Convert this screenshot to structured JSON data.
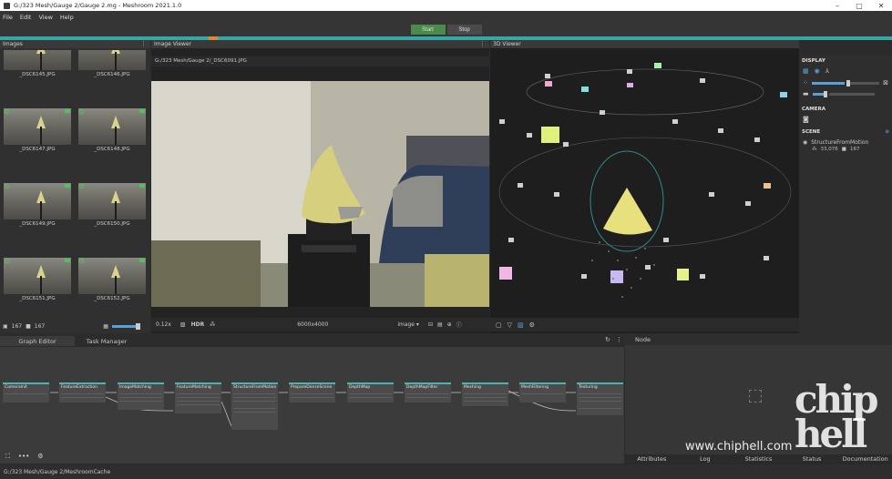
{
  "window": {
    "title": "G:/323 Mesh/Gauge 2/Gauge 2.mg - Meshroom 2021.1.0"
  },
  "menu": [
    "File",
    "Edit",
    "View",
    "Help"
  ],
  "toolbar": {
    "start_label": "Start",
    "stop_label": "Stop"
  },
  "colors": {
    "accent": "#35a7a7",
    "start": "#4a8a4a",
    "stop": "#4a4a4a",
    "progress_marker": "#e08a27",
    "camera_ok": "#4fc25b"
  },
  "images_panel": {
    "title": "Images",
    "thumbnails": [
      "_DSC6145.JPG",
      "_DSC6146.JPG",
      "_DSC6147.JPG",
      "_DSC6148.JPG",
      "_DSC6149.JPG",
      "_DSC6150.JPG",
      "_DSC6151.JPG",
      "_DSC6152.JPG"
    ],
    "image_count": "167",
    "camera_count": "167"
  },
  "image_viewer": {
    "title": "Image Viewer",
    "path": "G:/323 Mesh/Gauge 2/_DSC6091.JPG",
    "zoom": "0.12x",
    "hdr_label": "HDR",
    "resolution": "6000x4000",
    "mode": "image"
  },
  "viewer_3d": {
    "title": "3D Viewer"
  },
  "side_panel": {
    "display_label": "DISPLAY",
    "camera_label": "CAMERA",
    "scene_label": "SCENE",
    "scene_item": "StructureFromMotion",
    "points": "33,076",
    "cameras": "167"
  },
  "bottom_tabs": {
    "graph_editor": "Graph Editor",
    "task_manager": "Task Manager"
  },
  "graph_nodes": [
    {
      "name": "CameraInit"
    },
    {
      "name": "FeatureExtraction"
    },
    {
      "name": "ImageMatching"
    },
    {
      "name": "FeatureMatching"
    },
    {
      "name": "StructureFromMotion"
    },
    {
      "name": "PrepareDenseScene"
    },
    {
      "name": "DepthMap"
    },
    {
      "name": "DepthMapFilter"
    },
    {
      "name": "Meshing"
    },
    {
      "name": "MeshFiltering"
    },
    {
      "name": "Texturing"
    }
  ],
  "node_panel": {
    "title": "Node",
    "tabs": [
      "Attributes",
      "Log",
      "Statistics",
      "Status",
      "Documentation"
    ]
  },
  "status_bar": {
    "cache_path": "G:/323 Mesh/Gauge 2/MeshroomCache"
  },
  "watermark": {
    "logo_text": "chip hell",
    "url": "www.chiphell.com"
  }
}
